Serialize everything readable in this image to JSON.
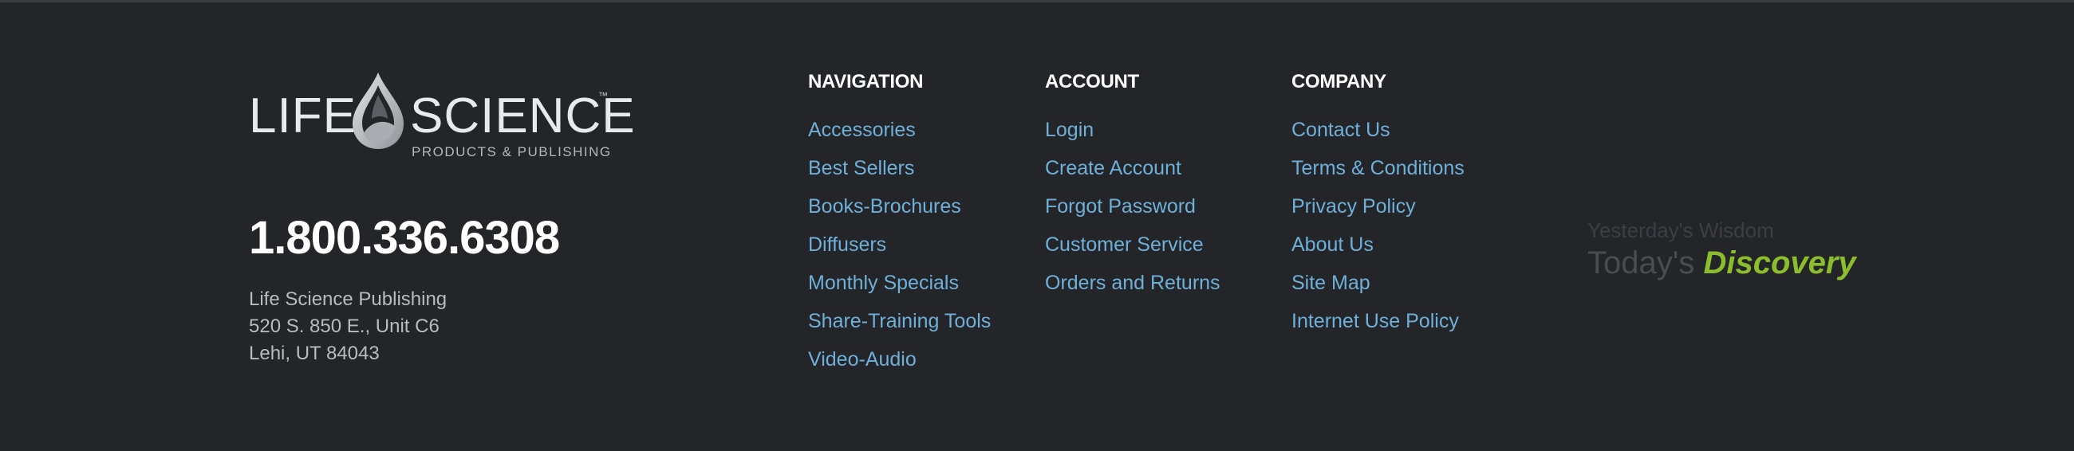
{
  "brand": {
    "logo_left": "LIFE",
    "logo_right": "SCIENCE",
    "logo_tm": "™",
    "logo_sub": "PRODUCTS & PUBLISHING",
    "phone": "1.800.336.6308",
    "address": [
      "Life Science Publishing",
      "520 S. 850 E., Unit C6",
      "Lehi, UT 84043"
    ]
  },
  "columns": {
    "navigation": {
      "heading": "NAVIGATION",
      "items": [
        "Accessories",
        "Best Sellers",
        "Books-Brochures",
        "Diffusers",
        "Monthly Specials",
        "Share-Training Tools",
        "Video-Audio"
      ]
    },
    "account": {
      "heading": "ACCOUNT",
      "items": [
        "Login",
        "Create Account",
        "Forgot Password",
        "Customer Service",
        "Orders and Returns"
      ]
    },
    "company": {
      "heading": "COMPANY",
      "items": [
        "Contact Us",
        "Terms & Conditions",
        "Privacy Policy",
        "About Us",
        "Site Map",
        "Internet Use Policy"
      ]
    }
  },
  "tagline": {
    "small": "Yesterday's Wisdom",
    "big_prefix": "Today's",
    "big_accent": "Discovery"
  },
  "colors": {
    "background": "#242529",
    "link": "#6fb0d9",
    "heading": "#ffffff",
    "accent": "#8bbd2c"
  }
}
